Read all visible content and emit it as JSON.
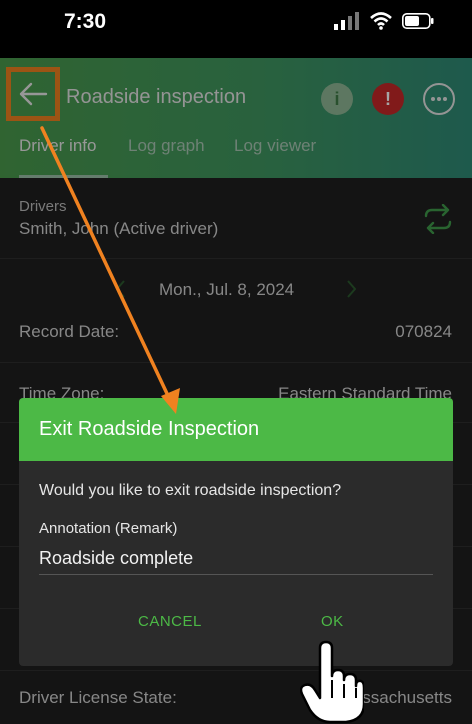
{
  "status_bar": {
    "time": "7:30"
  },
  "header": {
    "title": "Roadside inspection",
    "info_icon": "i",
    "alert_icon": "!",
    "tabs": [
      "Driver info",
      "Log graph",
      "Log viewer"
    ]
  },
  "drivers": {
    "label": "Drivers",
    "value": "Smith, John (Active driver)"
  },
  "date_nav": {
    "date": "Mon., Jul. 8, 2024"
  },
  "fields": [
    {
      "label": "Record Date:",
      "value": "070824"
    },
    {
      "label": "Time Zone:",
      "value": "Eastern Standard Time"
    },
    {
      "label": "Driver License State:",
      "value": "ssachusetts"
    }
  ],
  "dialog": {
    "title": "Exit Roadside Inspection",
    "message": "Would you like to exit roadside inspection?",
    "annotation_label": "Annotation (Remark)",
    "annotation_value": "Roadside complete",
    "cancel_label": "CANCEL",
    "ok_label": "OK"
  },
  "colors": {
    "accent_green": "#4cb946",
    "highlight_orange": "#f08220",
    "alert_red": "#c62828"
  }
}
